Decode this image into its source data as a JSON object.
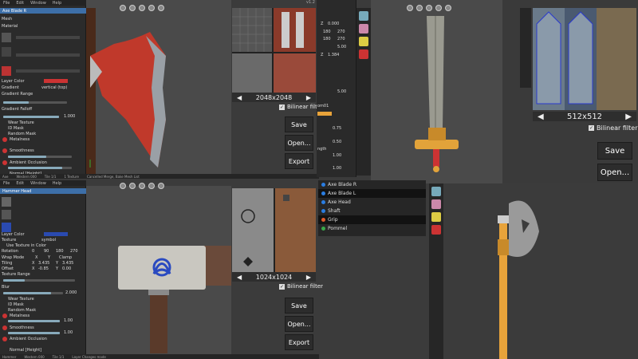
{
  "top_left_window": {
    "menu": [
      "File",
      "Edit",
      "Window",
      "Help"
    ],
    "title": "Axe Blade R",
    "items": [
      "Mesh",
      "Material"
    ],
    "layer_color_label": "Layer Color",
    "gradient_label": "Gradient",
    "gradient_value": "vertical (top)",
    "gradient_range_label": "Gradient Range",
    "gradient_falloff_label": "Gradient Falloff",
    "sub_items": [
      "Wear Texture",
      "ID Mask",
      "Random Mask",
      "Metalness",
      "Smoothness",
      "Ambient Occlusion",
      "Normal [Height]"
    ],
    "gradient_falloff_value": "1.000",
    "status": [
      "Axe",
      "Western 000",
      "Tile 1/1",
      "1 Texture",
      "Cancelled Merge, Bake Mesh List"
    ]
  },
  "bottom_left_window": {
    "menu": [
      "File",
      "Edit",
      "Window",
      "Help"
    ],
    "title": "Hammer Head",
    "layer_color_label": "Layer Color",
    "texture_label": "Texture",
    "texture_value": "symbol",
    "use_texture_label": "Use Texture in Color",
    "rotation_label": "Rotation",
    "rotation_values": [
      "0",
      "90",
      "180",
      "270"
    ],
    "wrap_mode_label": "Wrap Mode",
    "wrap_values": [
      "X",
      "Y",
      "Clamp"
    ],
    "tiling_label": "Tiling",
    "tiling_values": [
      "X",
      "3.435",
      "Y",
      "3.435"
    ],
    "offset_label": "Offset",
    "offset_values": [
      "X",
      "-0.85",
      "Y",
      "0.00"
    ],
    "texture_range_label": "Texture Range",
    "blur_label": "Blur",
    "blur_value": "2.000",
    "sub_items": [
      "Wear Texture",
      "ID Mask",
      "Random Mask",
      "Metalness",
      "Smoothness",
      "Ambient Occlusion",
      "Normal [Height]"
    ],
    "metalness_value": "1.00",
    "smoothness_value": "1.00",
    "status": [
      "Hammer",
      "Western 000",
      "Tile 1/1",
      "Layer Changes made"
    ]
  },
  "top_texture_preview": {
    "resolution": "2048x2048",
    "bilinear_label": "Bilinear filter",
    "buttons": [
      "Save",
      "Open...",
      "Export"
    ]
  },
  "bottom_texture_preview": {
    "resolution": "1024x1024",
    "bilinear_label": "Bilinear filter",
    "buttons": [
      "Save",
      "Open...",
      "Export"
    ]
  },
  "right_texture_preview": {
    "resolution": "512x512",
    "bilinear_label": "Bilinear filter",
    "buttons": [
      "Save",
      "Open..."
    ]
  },
  "middle_panel": {
    "coords": [
      "Z",
      "0.000",
      "180",
      "270",
      "180",
      "270",
      "5.00",
      "Z",
      "1.384"
    ],
    "values": [
      "5.00",
      "0.75",
      "0.50",
      "1.00",
      "1.00"
    ],
    "labels": [
      "om01",
      "ngth"
    ]
  },
  "part_list": {
    "items": [
      {
        "label": "Axe Blade R",
        "color": "#2a7de1"
      },
      {
        "label": "Axe Blade L",
        "color": "#2a7de1"
      },
      {
        "label": "Axe Head",
        "color": "#2a7de1"
      },
      {
        "label": "Shaft",
        "color": "#2a7de1"
      },
      {
        "label": "Grip",
        "color": "#e05a2a"
      },
      {
        "label": "Pommel",
        "color": "#3aa84a"
      }
    ]
  },
  "version": "v1.2",
  "colors": {
    "accent": "#3d6fa8",
    "red": "#cc3333",
    "orange": "#e8a33a"
  }
}
